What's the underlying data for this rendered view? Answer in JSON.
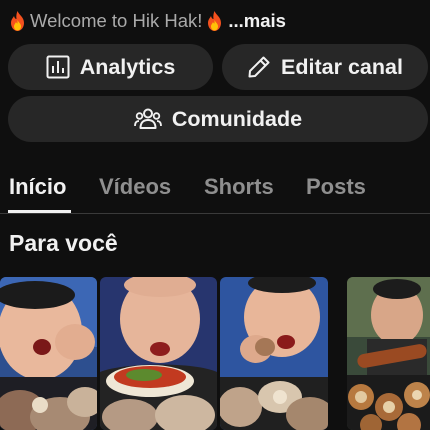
{
  "channel": {
    "description_text": "Welcome to Hik Hak!",
    "description_more": "...mais",
    "flame_icon": "fire-emoji"
  },
  "actions": {
    "analytics_label": "Analytics",
    "analytics_icon": "bar-chart-icon",
    "edit_label": "Editar canal",
    "edit_icon": "pencil-icon",
    "community_label": "Comunidade",
    "community_icon": "people-icon"
  },
  "tabs": [
    {
      "label": "Início",
      "active": true
    },
    {
      "label": "Vídeos",
      "active": false
    },
    {
      "label": "Shorts",
      "active": false
    },
    {
      "label": "Posts",
      "active": false
    }
  ],
  "section": {
    "title": "Para você"
  },
  "colors": {
    "background": "#0f0f0f",
    "pill": "#272727",
    "text": "#f1f1f1",
    "muted": "#8f8f8f"
  }
}
